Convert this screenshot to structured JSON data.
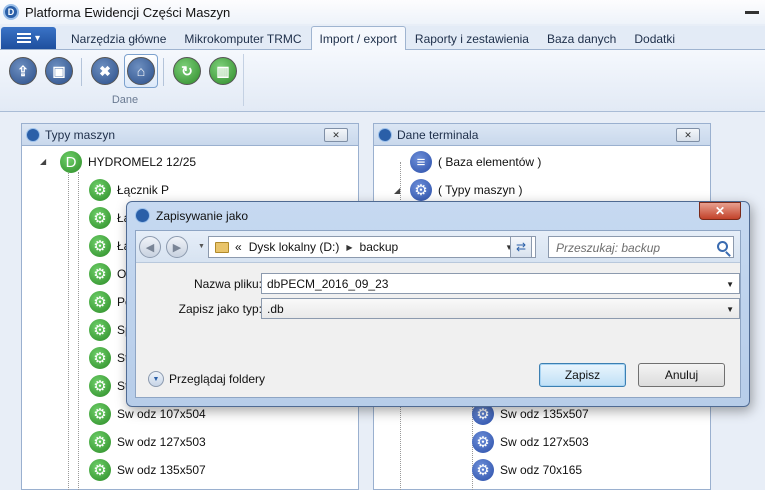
{
  "app": {
    "title": "Platforma Ewidencji Części Maszyn"
  },
  "ribbon": {
    "tabs": [
      {
        "label": "Narzędzia główne",
        "active": false
      },
      {
        "label": "Mikrokomputer TRMC",
        "active": false
      },
      {
        "label": "Import / export",
        "active": true
      },
      {
        "label": "Raporty i zestawienia",
        "active": false
      },
      {
        "label": "Baza danych",
        "active": false
      },
      {
        "label": "Dodatki",
        "active": false
      }
    ],
    "group_label": "Dane",
    "buttons": [
      "import-icon",
      "save-icon",
      "tools-icon",
      "home-icon",
      "refresh-icon",
      "delete-icon"
    ]
  },
  "left_panel": {
    "title": "Typy maszyn",
    "root": "HYDROMEL2 12/25",
    "items": [
      "Łącznik P",
      "Łą",
      "Łą",
      "Oś",
      "Po",
      "Sp",
      "St",
      "St",
      "Sw odz 107x504",
      "Sw odz 127x503",
      "Sw odz 135x507"
    ]
  },
  "right_panel": {
    "title": "Dane terminala",
    "nodes": [
      "( Baza elementów )",
      "( Typy maszyn )"
    ],
    "items": [
      "Sw odz 135x507",
      "Sw odz 127x503",
      "Sw odz 70x165"
    ]
  },
  "dialog": {
    "title": "Zapisywanie jako",
    "close_symbol": "✕",
    "breadcrumb_prefix": "«",
    "breadcrumb": [
      "Dysk lokalny (D:)",
      "backup"
    ],
    "search_placeholder": "Przeszukaj: backup",
    "filename_label": "Nazwa pliku:",
    "filename_value": "dbPECM_2016_09_23",
    "filetype_label": "Zapisz jako typ:",
    "filetype_value": ".db",
    "browse_folders_label": "Przeglądaj foldery",
    "save_label": "Zapisz",
    "cancel_label": "Anuluj"
  },
  "colors": {
    "accent": "#2a5fa8",
    "ribbon": "#e3ebf6",
    "dialog_frame": "#b7cde9",
    "close_red": "#c2422a"
  }
}
